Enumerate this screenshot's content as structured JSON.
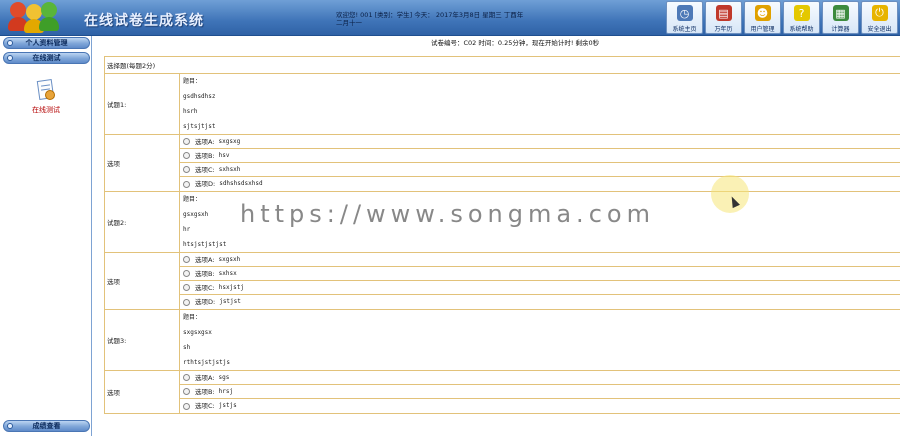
{
  "app": {
    "title": "在线试卷生成系统"
  },
  "user_info": {
    "line1": "欢迎您! 001 [类别：学生] 今天：  2017年3月8日 星期三  丁酉年",
    "line2": "二月十一"
  },
  "toolbar": [
    {
      "label": "系统主页",
      "icon": "clock-icon",
      "color": "#4d79b7"
    },
    {
      "label": "万年历",
      "icon": "calendar-icon",
      "color": "#c0392b"
    },
    {
      "label": "用户管理",
      "icon": "user-icon",
      "color": "#e0a100"
    },
    {
      "label": "系统帮助",
      "icon": "help-icon",
      "color": "#e4c800"
    },
    {
      "label": "计算器",
      "icon": "calculator-icon",
      "color": "#3d8b3d"
    },
    {
      "label": "安全退出",
      "icon": "power-icon",
      "color": "#e7b400"
    }
  ],
  "sidebar": {
    "personal": "个人资料管理",
    "online_test": "在线测试",
    "module_label": "在线测试",
    "results": "成绩查看"
  },
  "exam": {
    "info": "试卷编号：C02 时间：0.25分钟，现在开始计时! 剩余0秒",
    "section_title": "选择题(每题2分)",
    "option_label": "选项",
    "questions": [
      {
        "label": "试题1:",
        "stem": [
          "题目：",
          "gsdhsdhsz",
          "hsrh",
          "sjtsjtjst"
        ],
        "options": [
          {
            "key": "选项A:",
            "value": "sxgsxg"
          },
          {
            "key": "选项B:",
            "value": "hsv"
          },
          {
            "key": "选项C:",
            "value": "sxhsxh"
          },
          {
            "key": "选项D:",
            "value": "sdhshsdsxhsd"
          }
        ]
      },
      {
        "label": "试题2:",
        "stem": [
          "题目：",
          "gsxgsxh",
          "hr",
          "htsjstjstjst"
        ],
        "options": [
          {
            "key": "选项A:",
            "value": "sxgsxh"
          },
          {
            "key": "选项B:",
            "value": "sxhsx"
          },
          {
            "key": "选项C:",
            "value": "hsxjstj"
          },
          {
            "key": "选项D:",
            "value": "jstjst"
          }
        ]
      },
      {
        "label": "试题3:",
        "stem": [
          "题目：",
          "sxgsxgsx",
          "sh",
          "rthtsjstjstjs"
        ],
        "options": [
          {
            "key": "选项A:",
            "value": "sgs"
          },
          {
            "key": "选项B:",
            "value": "hrsj"
          },
          {
            "key": "选项C:",
            "value": "jstjs"
          }
        ]
      }
    ]
  },
  "watermark": "https://www.songma.com"
}
